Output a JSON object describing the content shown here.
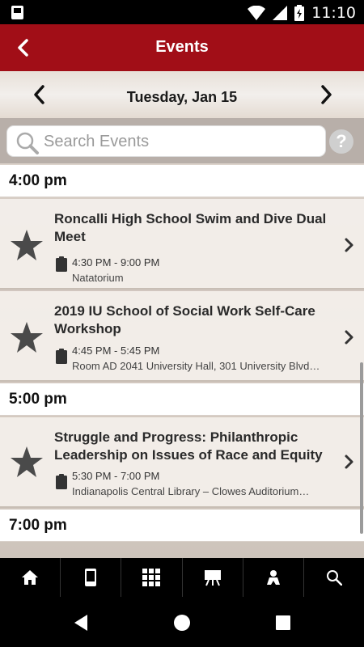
{
  "status_bar": {
    "time": "11:10"
  },
  "header": {
    "title": "Events"
  },
  "date_nav": {
    "date": "Tuesday, Jan 15"
  },
  "search": {
    "placeholder": "Search Events",
    "help_label": "?"
  },
  "groups": [
    {
      "time": "4:00 pm",
      "events": [
        {
          "title": "Roncalli High School Swim and Dive Dual Meet",
          "time": "4:30 PM - 9:00 PM",
          "location": "Natatorium"
        },
        {
          "title": "2019 IU School of Social Work Self-Care Workshop",
          "time": "4:45 PM - 5:45 PM",
          "location": "Room AD 2041 University Hall, 301 University Blvd…"
        }
      ]
    },
    {
      "time": "5:00 pm",
      "events": [
        {
          "title": "Struggle and Progress: Philanthropic Leadership on Issues of Race and Equity",
          "time": "5:30 PM - 7:00 PM",
          "location": "Indianapolis Central Library – Clowes Auditorium…"
        }
      ]
    },
    {
      "time": "7:00 pm",
      "events": []
    }
  ],
  "tab_bar": {
    "tabs": [
      "home-icon",
      "phone-icon",
      "qr-code-icon",
      "presentation-icon",
      "person-icon",
      "search-icon"
    ]
  },
  "colors": {
    "accent": "#a10e17",
    "star": "#4a4a4a"
  }
}
